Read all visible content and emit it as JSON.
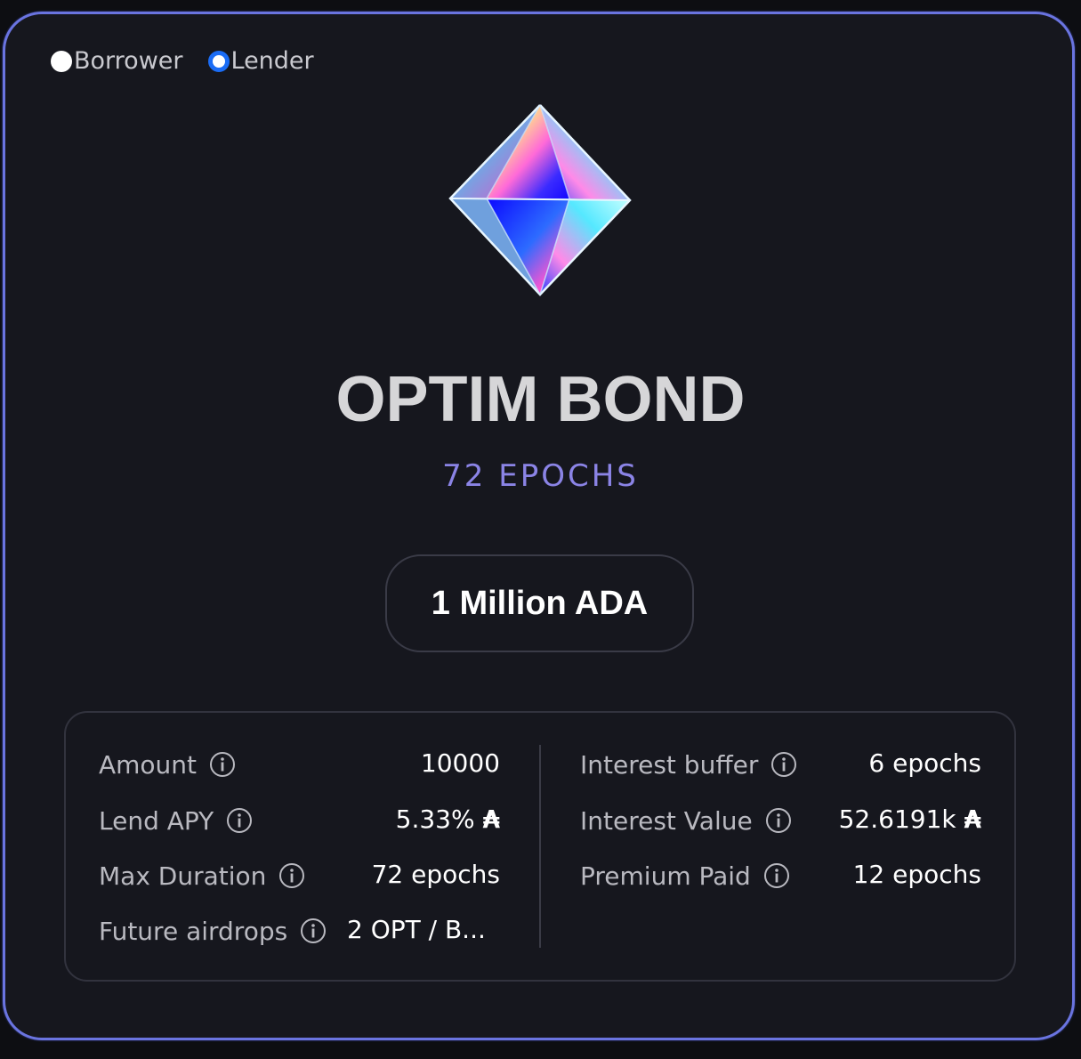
{
  "role_selector": {
    "options": [
      {
        "label": "Borrower",
        "selected": false
      },
      {
        "label": "Lender",
        "selected": true
      }
    ]
  },
  "bond": {
    "title": "OPTIM BOND",
    "subtitle": "72 EPOCHS",
    "amount_button": "1 Million ADA"
  },
  "details": {
    "left": [
      {
        "label": "Amount",
        "value": "10000",
        "icon": "info-icon"
      },
      {
        "label": "Lend APY",
        "value": "5.33%",
        "suffix": "₳",
        "icon": "info-icon"
      },
      {
        "label": "Max Duration",
        "value": "72 epochs",
        "icon": "info-icon"
      },
      {
        "label": "Future airdrops",
        "value": "2 OPT / B...",
        "icon": "info-icon"
      }
    ],
    "right": [
      {
        "label": "Interest buffer",
        "value": "6 epochs",
        "icon": "info-icon"
      },
      {
        "label": "Interest Value",
        "value": "52.6191k",
        "suffix": "₳",
        "icon": "info-icon"
      },
      {
        "label": "Premium Paid",
        "value": "12 epochs",
        "icon": "info-icon"
      }
    ]
  },
  "colors": {
    "accent": "#6a74e0",
    "radio_selected": "#1a6cf5",
    "subtitle": "#8b84e6",
    "card_bg": "#16171e"
  }
}
